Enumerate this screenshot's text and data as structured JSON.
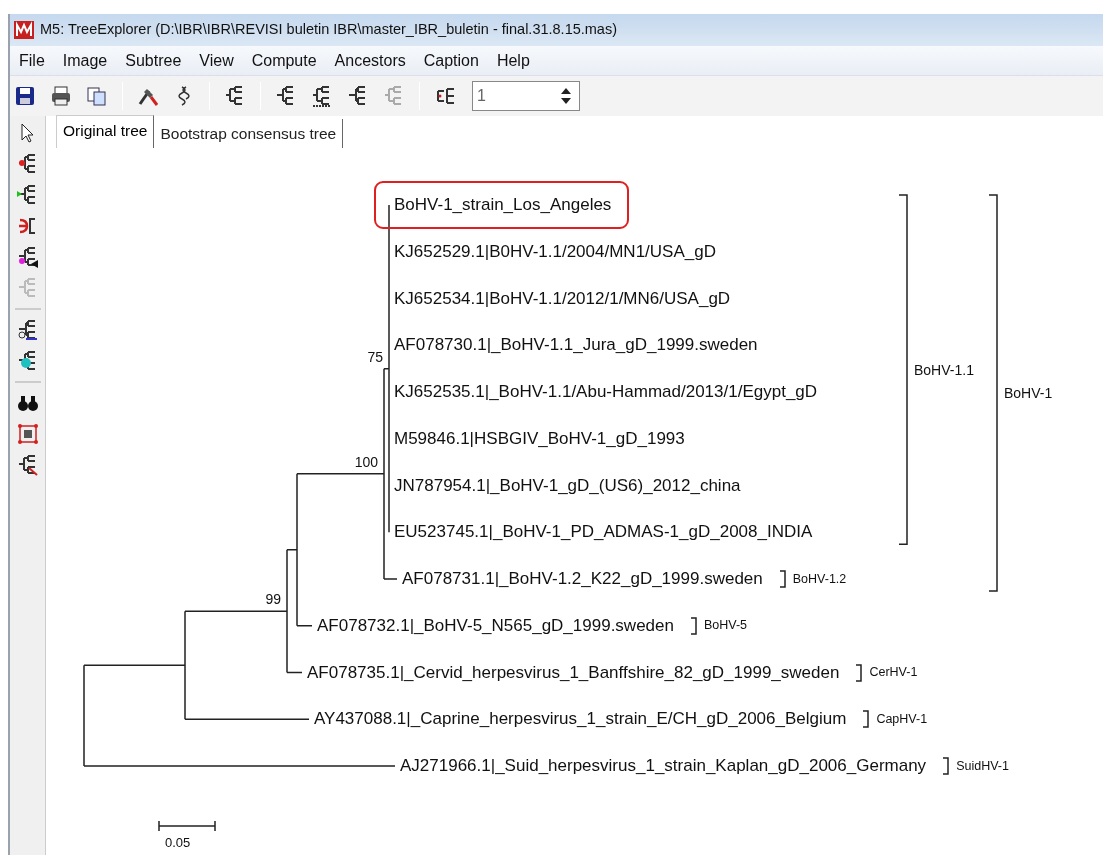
{
  "window": {
    "title": "M5: TreeExplorer (D:\\IBR\\IBR\\REVISI buletin IBR\\master_IBR_buletin - final.31.8.15.mas)"
  },
  "menu": [
    "File",
    "Image",
    "Subtree",
    "View",
    "Compute",
    "Ancestors",
    "Caption",
    "Help"
  ],
  "toolbar": {
    "spinner_value": "1"
  },
  "tabs": [
    {
      "label": "Original tree",
      "selected": true
    },
    {
      "label": "Bootstrap consensus tree",
      "selected": false
    }
  ],
  "tree": {
    "children": [
      {
        "children": [
          {
            "support": "99",
            "children": [
              {
                "children": [
                  {
                    "support": "100",
                    "clade": "BoHV-1",
                    "children": [
                      {
                        "support": "75",
                        "clade": "BoHV-1.1",
                        "children": [
                          {
                            "label": "BoHV-1_strain_Los_Angeles",
                            "highlighted": true
                          },
                          {
                            "label": "KJ652529.1|B0HV-1.1/2004/MN1/USA_gD",
                            "highlighted": false
                          },
                          {
                            "label": "KJ652534.1|BoHV-1.1/2012/1/MN6/USA_gD",
                            "highlighted": false
                          },
                          {
                            "label": "AF078730.1|_BoHV-1.1_Jura_gD_1999.sweden",
                            "highlighted": false
                          },
                          {
                            "label": "KJ652535.1|_BoHV-1.1/Abu-Hammad/2013/1/Egypt_gD",
                            "highlighted": false
                          },
                          {
                            "label": "M59846.1|HSBGIV_BoHV-1_gD_1993",
                            "highlighted": false
                          },
                          {
                            "label": "JN787954.1|_BoHV-1_gD_(US6)_2012_china",
                            "highlighted": false
                          },
                          {
                            "label": "EU523745.1|_BoHV-1_PD_ADMAS-1_gD_2008_INDIA",
                            "highlighted": false
                          }
                        ]
                      },
                      {
                        "label": "AF078731.1|_BoHV-1.2_K22_gD_1999.sweden",
                        "highlighted": false,
                        "clade": "BoHV-1.2"
                      }
                    ]
                  },
                  {
                    "label": "AF078732.1|_BoHV-5_N565_gD_1999.sweden",
                    "highlighted": false,
                    "clade": "BoHV-5"
                  }
                ]
              },
              {
                "label": "AF078735.1|_Cervid_herpesvirus_1_Banffshire_82_gD_1999_sweden",
                "highlighted": false,
                "clade": "CerHV-1"
              }
            ]
          },
          {
            "label": "AY437088.1|_Caprine_herpesvirus_1_strain_E/CH_gD_2006_Belgium",
            "highlighted": false,
            "clade": "CapHV-1"
          }
        ]
      },
      {
        "label": "AJ271966.1|_Suid_herpesvirus_1_strain_Kaplan_gD_2006_Germany",
        "highlighted": false,
        "clade": "SuidHV-1"
      }
    ]
  },
  "scale": {
    "label": "0.05"
  }
}
